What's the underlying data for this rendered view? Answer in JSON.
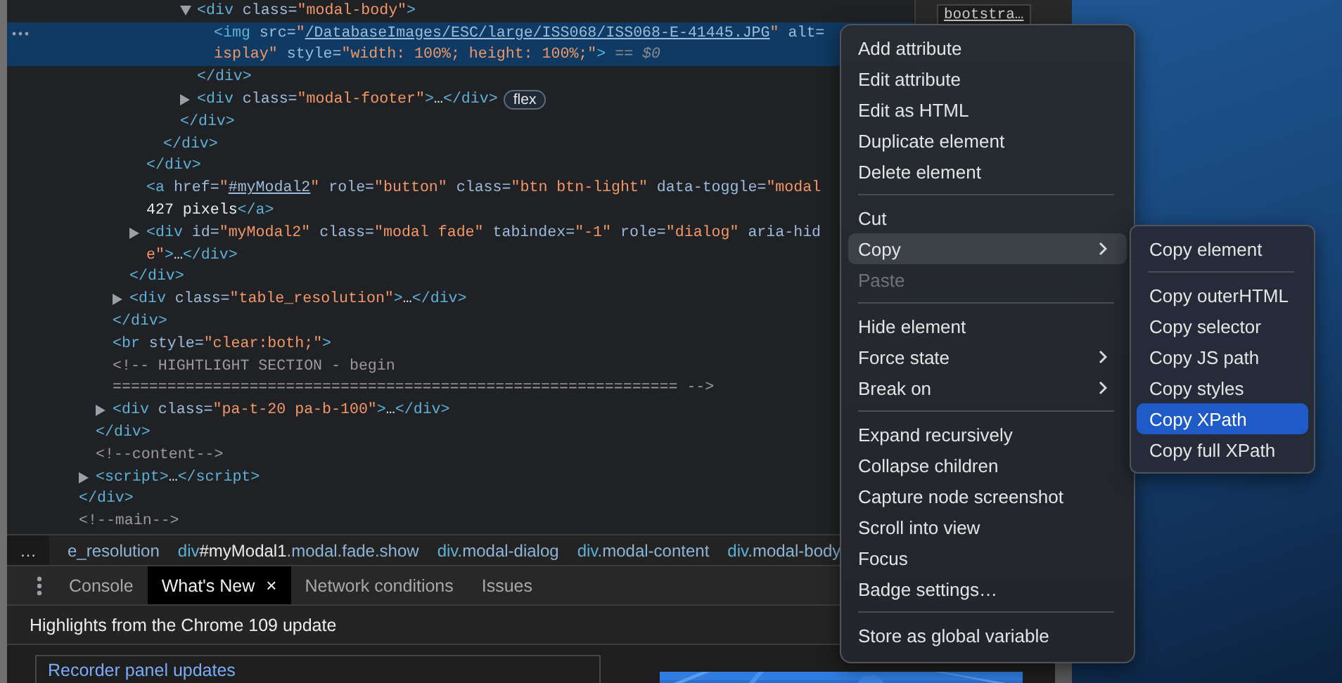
{
  "elements_tree": [
    {
      "children": [
        {
          "children": [
            {
              "children": [
                {
                  "children": [
                    {
                      "children": [
                        {
                          "children": [
                            {
                              "children": [
                                {
                                  "selected": false,
                                  "expanded": true,
                                  "lines": [
                                    [
                                      {
                                        "kind": "tag",
                                        "text": "<div"
                                      },
                                      {
                                        "kind": "attr",
                                        "text": " class="
                                      },
                                      {
                                        "kind": "value",
                                        "text": "\"modal-body\""
                                      },
                                      {
                                        "kind": "tag",
                                        "text": ">"
                                      }
                                    ]
                                  ],
                                  "children": [
                                    {
                                      "selected": true,
                                      "lines": [
                                        [
                                          {
                                            "kind": "tag",
                                            "text": "<img"
                                          },
                                          {
                                            "kind": "attr",
                                            "text": " src="
                                          },
                                          {
                                            "kind": "value",
                                            "text": "\""
                                          },
                                          {
                                            "kind": "link",
                                            "text": "/DatabaseImages/ESC/large/ISS068/ISS068-E-41445.JPG"
                                          },
                                          {
                                            "kind": "value",
                                            "text": "\""
                                          },
                                          {
                                            "kind": "attr",
                                            "text": " alt="
                                          }
                                        ],
                                        [
                                          {
                                            "kind": "value",
                                            "text": "isplay\""
                                          },
                                          {
                                            "kind": "attr",
                                            "text": " style="
                                          },
                                          {
                                            "kind": "value",
                                            "text": "\"width: 100%; height: 100%;\""
                                          },
                                          {
                                            "kind": "tag",
                                            "text": ">"
                                          },
                                          {
                                            "kind": "marker",
                                            "text": " == $0"
                                          }
                                        ]
                                      ]
                                    }
                                  ]
                                },
                                {
                                  "selected": false,
                                  "lines": [
                                    [
                                      {
                                        "kind": "tag",
                                        "text": "</div>"
                                      }
                                    ]
                                  ]
                                },
                                {
                                  "selected": false,
                                  "expanded": false,
                                  "badge": "flex",
                                  "lines": [
                                    [
                                      {
                                        "kind": "tag",
                                        "text": "<div"
                                      },
                                      {
                                        "kind": "attr",
                                        "text": " class="
                                      },
                                      {
                                        "kind": "value",
                                        "text": "\"modal-footer\""
                                      },
                                      {
                                        "kind": "tag",
                                        "text": ">"
                                      },
                                      {
                                        "kind": "text",
                                        "text": "…"
                                      },
                                      {
                                        "kind": "tag",
                                        "text": "</div>"
                                      }
                                    ]
                                  ]
                                }
                              ]
                            },
                            {
                              "selected": false,
                              "lines": [
                                [
                                  {
                                    "kind": "tag",
                                    "text": "</div>"
                                  }
                                ]
                              ]
                            }
                          ]
                        },
                        {
                          "selected": false,
                          "lines": [
                            [
                              {
                                "kind": "tag",
                                "text": "</div>"
                              }
                            ]
                          ]
                        }
                      ]
                    },
                    {
                      "selected": false,
                      "lines": [
                        [
                          {
                            "kind": "tag",
                            "text": "</div>"
                          }
                        ]
                      ]
                    },
                    {
                      "selected": false,
                      "lines": [
                        [
                          {
                            "kind": "tag",
                            "text": "<a"
                          },
                          {
                            "kind": "attr",
                            "text": " href="
                          },
                          {
                            "kind": "value",
                            "text": "\""
                          },
                          {
                            "kind": "link",
                            "text": "#myModal2"
                          },
                          {
                            "kind": "value",
                            "text": "\""
                          },
                          {
                            "kind": "attr",
                            "text": " role="
                          },
                          {
                            "kind": "value",
                            "text": "\"button\""
                          },
                          {
                            "kind": "attr",
                            "text": " class="
                          },
                          {
                            "kind": "value",
                            "text": "\"btn btn-light\""
                          },
                          {
                            "kind": "attr",
                            "text": " data-toggle="
                          },
                          {
                            "kind": "value",
                            "text": "\"modal"
                          }
                        ],
                        [
                          {
                            "kind": "text",
                            "text": "427 pixels"
                          },
                          {
                            "kind": "tag",
                            "text": "</a>"
                          }
                        ]
                      ]
                    },
                    {
                      "selected": false,
                      "expanded": false,
                      "lines": [
                        [
                          {
                            "kind": "tag",
                            "text": "<div"
                          },
                          {
                            "kind": "attr",
                            "text": " id="
                          },
                          {
                            "kind": "value",
                            "text": "\"myModal2\""
                          },
                          {
                            "kind": "attr",
                            "text": " class="
                          },
                          {
                            "kind": "value",
                            "text": "\"modal fade\""
                          },
                          {
                            "kind": "attr",
                            "text": " tabindex="
                          },
                          {
                            "kind": "value",
                            "text": "\"-1\""
                          },
                          {
                            "kind": "attr",
                            "text": " role="
                          },
                          {
                            "kind": "value",
                            "text": "\"dialog\""
                          },
                          {
                            "kind": "attr",
                            "text": " aria-hid"
                          }
                        ],
                        [
                          {
                            "kind": "value",
                            "text": "e\""
                          },
                          {
                            "kind": "tag",
                            "text": ">"
                          },
                          {
                            "kind": "text",
                            "text": "…"
                          },
                          {
                            "kind": "tag",
                            "text": "</div>"
                          }
                        ]
                      ]
                    }
                  ]
                },
                {
                  "selected": false,
                  "lines": [
                    [
                      {
                        "kind": "tag",
                        "text": "</div>"
                      }
                    ]
                  ]
                },
                {
                  "selected": false,
                  "expanded": false,
                  "lines": [
                    [
                      {
                        "kind": "tag",
                        "text": "<div"
                      },
                      {
                        "kind": "attr",
                        "text": " class="
                      },
                      {
                        "kind": "value",
                        "text": "\"table_resolution\""
                      },
                      {
                        "kind": "tag",
                        "text": ">"
                      },
                      {
                        "kind": "text",
                        "text": "…"
                      },
                      {
                        "kind": "tag",
                        "text": "</div>"
                      }
                    ]
                  ]
                }
              ]
            },
            {
              "selected": false,
              "lines": [
                [
                  {
                    "kind": "tag",
                    "text": "</div>"
                  }
                ]
              ]
            },
            {
              "selected": false,
              "lines": [
                [
                  {
                    "kind": "tag",
                    "text": "<br"
                  },
                  {
                    "kind": "attr",
                    "text": " style="
                  },
                  {
                    "kind": "value",
                    "text": "\"clear:both;\""
                  },
                  {
                    "kind": "tag",
                    "text": ">"
                  }
                ]
              ]
            },
            {
              "selected": false,
              "lines": [
                [
                  {
                    "kind": "comment",
                    "text": "<!-- HIGHTLIGHT SECTION - begin"
                  }
                ],
                [
                  {
                    "kind": "comment",
                    "text": "============================================================== -->"
                  }
                ]
              ]
            },
            {
              "selected": false,
              "expanded": false,
              "lines": [
                [
                  {
                    "kind": "tag",
                    "text": "<div"
                  },
                  {
                    "kind": "attr",
                    "text": " class="
                  },
                  {
                    "kind": "value",
                    "text": "\"pa-t-20 pa-b-100\""
                  },
                  {
                    "kind": "tag",
                    "text": ">"
                  },
                  {
                    "kind": "text",
                    "text": "…"
                  },
                  {
                    "kind": "tag",
                    "text": "</div>"
                  }
                ]
              ]
            }
          ]
        },
        {
          "selected": false,
          "lines": [
            [
              {
                "kind": "tag",
                "text": "</div>"
              }
            ]
          ]
        },
        {
          "selected": false,
          "lines": [
            [
              {
                "kind": "comment",
                "text": "<!--content-->"
              }
            ]
          ]
        },
        {
          "selected": false,
          "expanded": false,
          "lines": [
            [
              {
                "kind": "tag",
                "text": "<script>"
              },
              {
                "kind": "text",
                "text": "…"
              },
              {
                "kind": "tag",
                "text": "</script>"
              }
            ]
          ]
        }
      ]
    },
    {
      "selected": false,
      "lines": [
        [
          {
            "kind": "tag",
            "text": "</div>"
          }
        ]
      ]
    },
    {
      "selected": false,
      "lines": [
        [
          {
            "kind": "comment",
            "text": "<!--main-->"
          }
        ]
      ]
    }
  ],
  "styles_pane": {
    "source_link": "bootstra…"
  },
  "breadcrumbs": {
    "more": "…",
    "items": [
      [
        {
          "kind": "cls",
          "text": "e_resolution"
        }
      ],
      [
        {
          "kind": "tag",
          "text": "div"
        },
        {
          "kind": "id",
          "text": "#myModal1"
        },
        {
          "kind": "cls",
          "text": ".modal.fade.show"
        }
      ],
      [
        {
          "kind": "tag",
          "text": "div"
        },
        {
          "kind": "cls",
          "text": ".modal-dialog"
        }
      ],
      [
        {
          "kind": "tag",
          "text": "div"
        },
        {
          "kind": "cls",
          "text": ".modal-content"
        }
      ],
      [
        {
          "kind": "tag",
          "text": "div"
        },
        {
          "kind": "cls",
          "text": ".modal-body"
        }
      ]
    ]
  },
  "drawer_tabs": [
    {
      "label": "Console",
      "selected": false
    },
    {
      "label": "What's New",
      "selected": true,
      "close": "×"
    },
    {
      "label": "Network conditions",
      "selected": false
    },
    {
      "label": "Issues",
      "selected": false
    }
  ],
  "whats_new": {
    "heading": "Highlights from the Chrome 109 update",
    "card_title": "Recorder panel updates"
  },
  "context_menu": {
    "items": [
      {
        "kind": "item",
        "label": "Add attribute",
        "selected": false,
        "disabled": false,
        "submenu": false
      },
      {
        "kind": "item",
        "label": "Edit attribute",
        "selected": false,
        "disabled": false,
        "submenu": false
      },
      {
        "kind": "item",
        "label": "Edit as HTML",
        "selected": false,
        "disabled": false,
        "submenu": false
      },
      {
        "kind": "item",
        "label": "Duplicate element",
        "selected": false,
        "disabled": false,
        "submenu": false
      },
      {
        "kind": "item",
        "label": "Delete element",
        "selected": false,
        "disabled": false,
        "submenu": false
      },
      {
        "kind": "separator"
      },
      {
        "kind": "item",
        "label": "Cut",
        "selected": false,
        "disabled": false,
        "submenu": false
      },
      {
        "kind": "item",
        "label": "Copy",
        "selected": true,
        "disabled": false,
        "submenu": true
      },
      {
        "kind": "item",
        "label": "Paste",
        "selected": false,
        "disabled": true,
        "submenu": false
      },
      {
        "kind": "separator"
      },
      {
        "kind": "item",
        "label": "Hide element",
        "selected": false,
        "disabled": false,
        "submenu": false
      },
      {
        "kind": "item",
        "label": "Force state",
        "selected": false,
        "disabled": false,
        "submenu": true
      },
      {
        "kind": "item",
        "label": "Break on",
        "selected": false,
        "disabled": false,
        "submenu": true
      },
      {
        "kind": "separator"
      },
      {
        "kind": "item",
        "label": "Expand recursively",
        "selected": false,
        "disabled": false,
        "submenu": false
      },
      {
        "kind": "item",
        "label": "Collapse children",
        "selected": false,
        "disabled": false,
        "submenu": false
      },
      {
        "kind": "item",
        "label": "Capture node screenshot",
        "selected": false,
        "disabled": false,
        "submenu": false
      },
      {
        "kind": "item",
        "label": "Scroll into view",
        "selected": false,
        "disabled": false,
        "submenu": false
      },
      {
        "kind": "item",
        "label": "Focus",
        "selected": false,
        "disabled": false,
        "submenu": false
      },
      {
        "kind": "item",
        "label": "Badge settings…",
        "selected": false,
        "disabled": false,
        "submenu": false
      },
      {
        "kind": "separator"
      },
      {
        "kind": "item",
        "label": "Store as global variable",
        "selected": false,
        "disabled": false,
        "submenu": false
      }
    ],
    "submenu": {
      "items": [
        {
          "kind": "item",
          "label": "Copy element",
          "selected": false
        },
        {
          "kind": "separator"
        },
        {
          "kind": "item",
          "label": "Copy outerHTML",
          "selected": false
        },
        {
          "kind": "item",
          "label": "Copy selector",
          "selected": false
        },
        {
          "kind": "item",
          "label": "Copy JS path",
          "selected": false
        },
        {
          "kind": "item",
          "label": "Copy styles",
          "selected": false
        },
        {
          "kind": "item",
          "label": "Copy XPath",
          "selected": true
        },
        {
          "kind": "item",
          "label": "Copy full XPath",
          "selected": false
        }
      ]
    }
  }
}
